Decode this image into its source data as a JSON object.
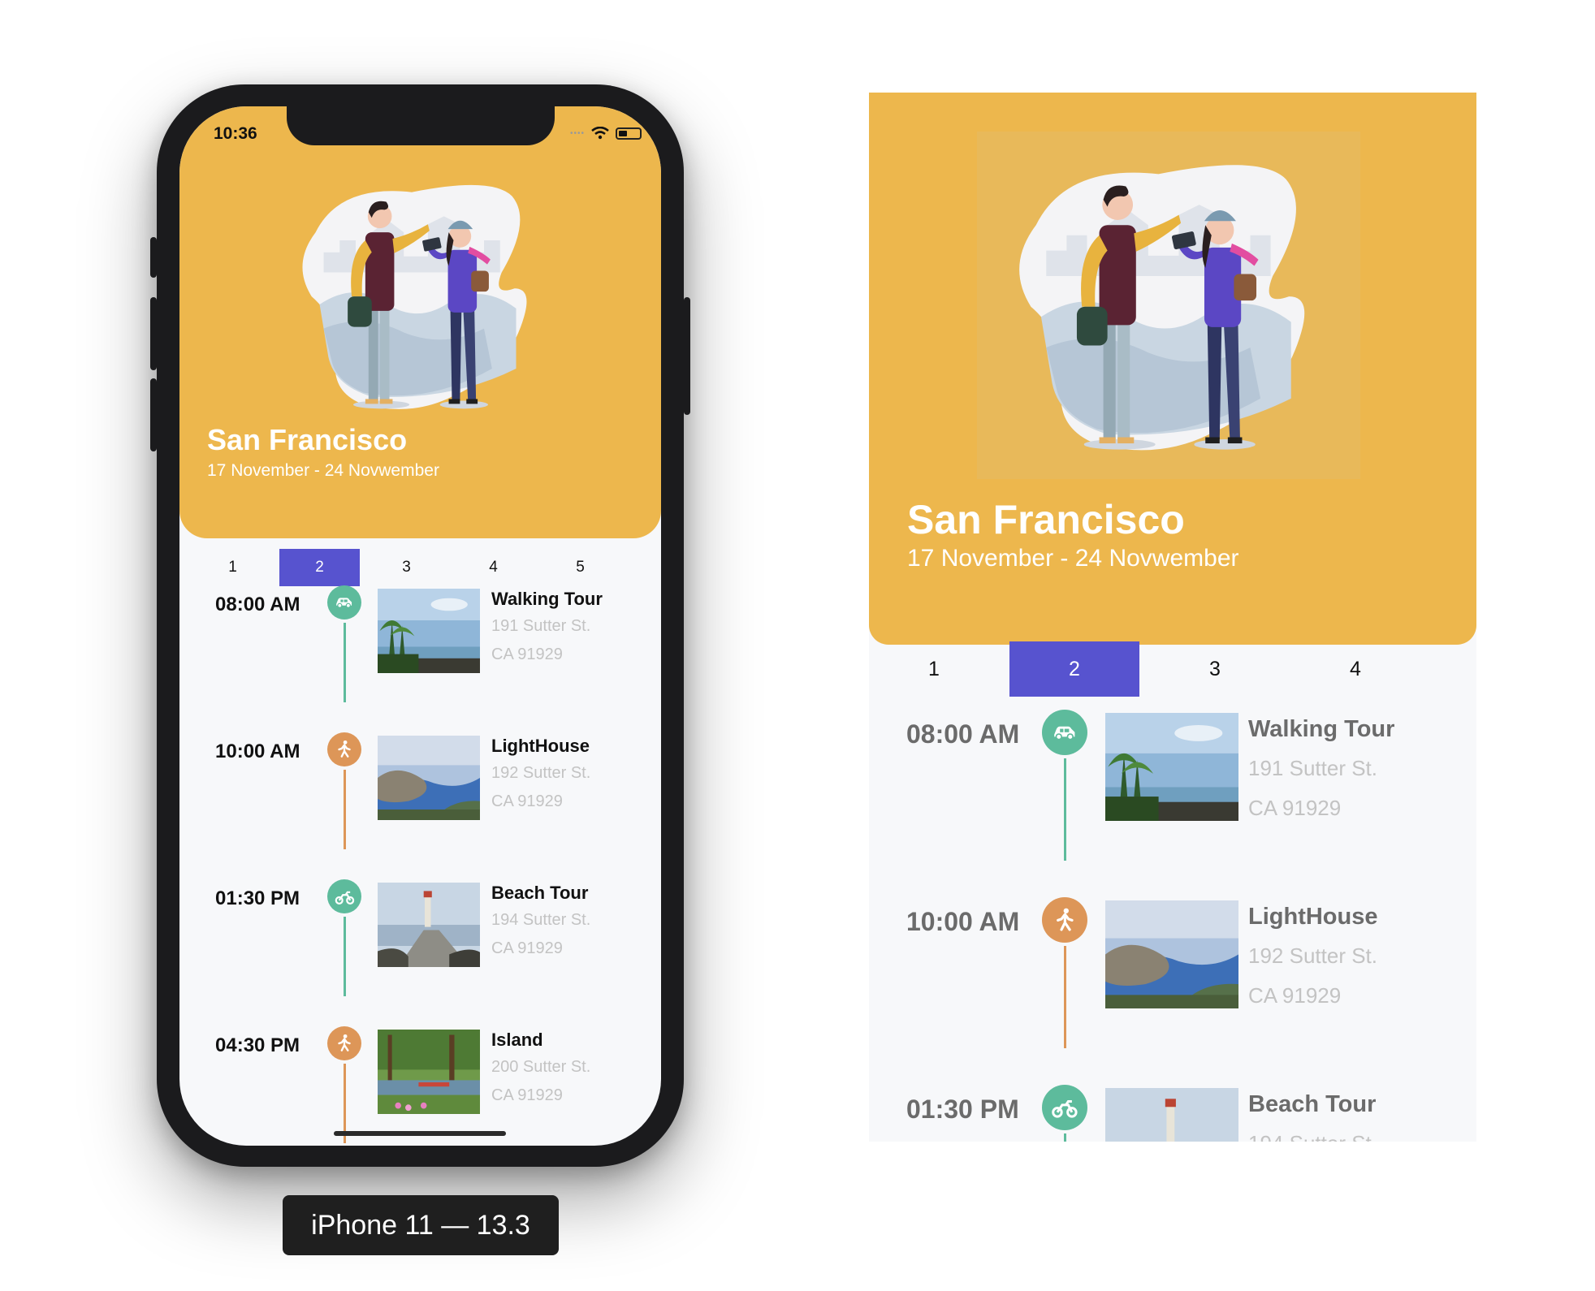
{
  "status_bar": {
    "time": "10:36"
  },
  "trip": {
    "city": "San Francisco",
    "dates": "17 November - 24 Novwember"
  },
  "device_tabs": [
    "1",
    "2",
    "3",
    "4",
    "5"
  ],
  "preview_tabs": [
    "1",
    "2",
    "3",
    "4"
  ],
  "active_tab": "2",
  "activities": [
    {
      "time": "08:00 AM",
      "title": "Walking Tour",
      "address1": "191 Sutter St.",
      "address2": "CA 91929",
      "icon": "car-icon",
      "color": "#5dbb9c"
    },
    {
      "time": "10:00 AM",
      "title": "LightHouse",
      "address1": "192 Sutter St.",
      "address2": "CA 91929",
      "icon": "walking-icon",
      "color": "#dd9658"
    },
    {
      "time": "01:30 PM",
      "title": "Beach Tour",
      "address1": "194 Sutter St.",
      "address2": "CA 91929",
      "icon": "motorcycle-icon",
      "color": "#5dbb9c"
    },
    {
      "time": "04:30 PM",
      "title": "Island",
      "address1": "200 Sutter St.",
      "address2": "CA 91929",
      "icon": "walking-icon",
      "color": "#dd9658"
    }
  ],
  "device_label": "iPhone 11 — 13.3",
  "colors": {
    "header": "#edb74d",
    "active_tab": "#5753cf",
    "teal": "#5dbb9c",
    "orange": "#dd9658"
  }
}
